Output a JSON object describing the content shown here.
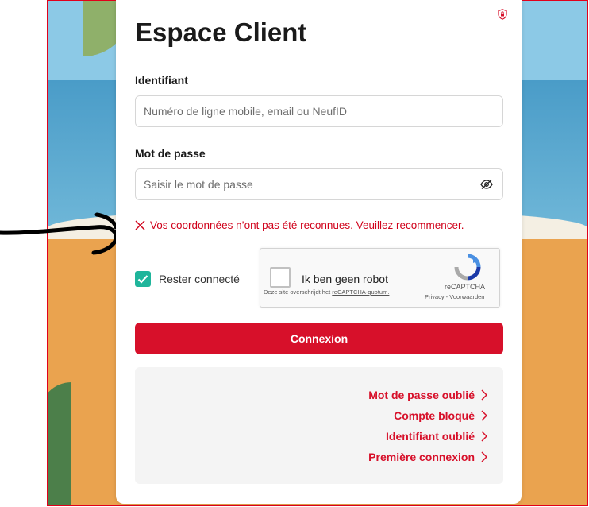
{
  "page": {
    "title": "Espace Client",
    "accent_color": "#d7102a",
    "check_color": "#1fb59b"
  },
  "icons": {
    "top_right": "shield-lock-icon",
    "password_toggle": "eye-slash-icon",
    "error": "x-icon",
    "link_chevron": "chevron-right-icon"
  },
  "form": {
    "identifier_label": "Identifiant",
    "identifier_placeholder": "Numéro de ligne mobile, email ou NeufID",
    "identifier_value": "",
    "password_label": "Mot de passe",
    "password_placeholder": "Saisir le mot de passe",
    "password_value": "",
    "error_message": "Vos coordonnées n’ont pas été reconnues. Veuillez recommencer.",
    "remember_label": "Rester connecté",
    "remember_checked": true,
    "submit_label": "Connexion"
  },
  "recaptcha": {
    "checkbox_label": "Ik ben geen robot",
    "brand": "reCAPTCHA",
    "privacy": "Privacy",
    "terms": "Voorwaarden",
    "quota_text": "Deze site overschrijdt het",
    "quota_link": "reCAPTCHA-quotum."
  },
  "help_links": [
    {
      "label": "Mot de passe oublié"
    },
    {
      "label": "Compte bloqué"
    },
    {
      "label": "Identifiant oublié"
    },
    {
      "label": "Première connexion"
    }
  ]
}
